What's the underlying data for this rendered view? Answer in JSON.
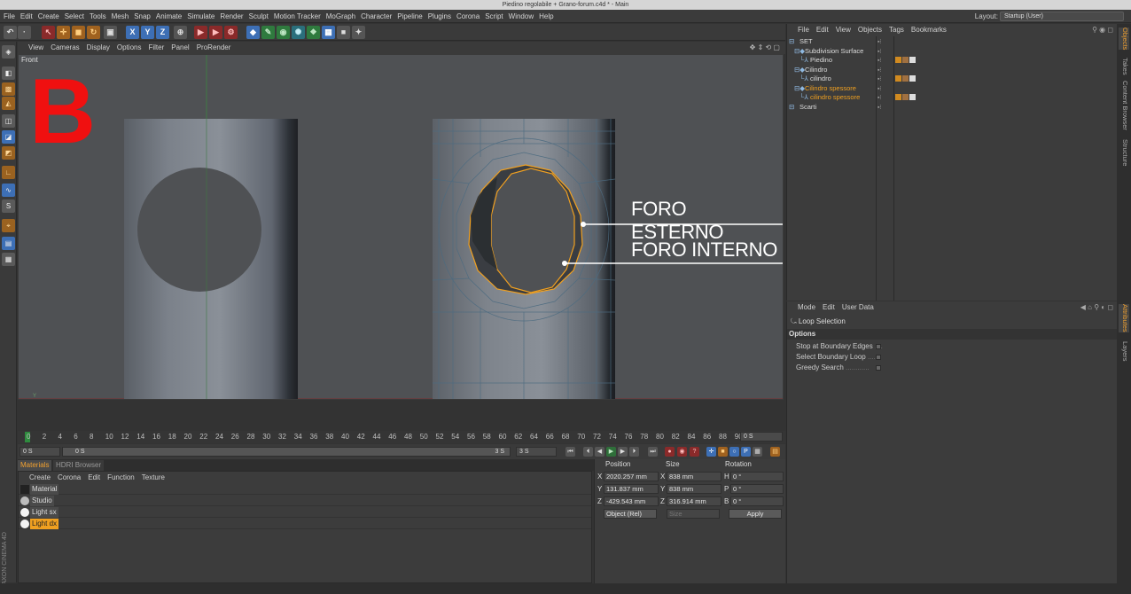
{
  "window": {
    "title": "Piedino regolabile + Grano-forum.c4d * - Main"
  },
  "menu": [
    "File",
    "Edit",
    "Create",
    "Select",
    "Tools",
    "Mesh",
    "Snap",
    "Animate",
    "Simulate",
    "Render",
    "Sculpt",
    "Motion Tracker",
    "MoGraph",
    "Character",
    "Pipeline",
    "Plugins",
    "Corona",
    "Script",
    "Window",
    "Help"
  ],
  "layout": {
    "label": "Layout:",
    "value": "Startup (User)"
  },
  "toolbar_axes": [
    "X",
    "Y",
    "Z"
  ],
  "viewport": {
    "menu": [
      "View",
      "Cameras",
      "Display",
      "Options",
      "Filter",
      "Panel",
      "ProRender"
    ],
    "label": "Front",
    "overlay_letter": "B",
    "annotations": {
      "outer": "FORO ESTERNO",
      "inner": "FORO INTERNO"
    },
    "axis": {
      "y": "Y",
      "x": "X",
      "z": "Z"
    }
  },
  "timeline": {
    "ticks": [
      "0",
      "2",
      "4",
      "6",
      "8",
      "10",
      "12",
      "14",
      "16",
      "18",
      "20",
      "22",
      "24",
      "26",
      "28",
      "30",
      "32",
      "34",
      "36",
      "38",
      "40",
      "42",
      "44",
      "46",
      "48",
      "50",
      "52",
      "54",
      "56",
      "58",
      "60",
      "62",
      "64",
      "66",
      "68",
      "70",
      "72",
      "74",
      "76",
      "78",
      "80",
      "82",
      "84",
      "86",
      "88",
      "90"
    ],
    "current": "0 S",
    "start": "0 S",
    "range_start": "0 S",
    "range_end": "3 S",
    "end": "3 S"
  },
  "materials": {
    "tabs": [
      "Materials",
      "HDRI Browser"
    ],
    "menu": [
      "Create",
      "Corona",
      "Edit",
      "Function",
      "Texture"
    ],
    "items": [
      {
        "name": "Material",
        "color": "#222222"
      },
      {
        "name": "Studio",
        "color": "#bbbbbb"
      },
      {
        "name": "Light sx",
        "color": "#f4f4f4"
      },
      {
        "name": "Light dx",
        "color": "#f4f4f4"
      }
    ]
  },
  "coords": {
    "headers": {
      "position": "Position",
      "size": "Size",
      "rotation": "Rotation"
    },
    "rows": [
      {
        "axis": "X",
        "pos": "2020.257 mm",
        "size_axis": "X",
        "size": "838 mm",
        "rot_axis": "H",
        "rot": "0 °"
      },
      {
        "axis": "Y",
        "pos": "131.837 mm",
        "size_axis": "Y",
        "size": "838 mm",
        "rot_axis": "P",
        "rot": "0 °"
      },
      {
        "axis": "Z",
        "pos": "-429.543 mm",
        "size_axis": "Z",
        "size": "316.914 mm",
        "rot_axis": "B",
        "rot": "0 °"
      }
    ],
    "mode": "Object (Rel)",
    "size_mode": "Size",
    "apply": "Apply"
  },
  "object_manager": {
    "menu": [
      "File",
      "Edit",
      "View",
      "Objects",
      "Tags",
      "Bookmarks"
    ],
    "objects": [
      {
        "name": "SET",
        "color": "#dddddd",
        "indent": 0,
        "has_tags": false
      },
      {
        "name": "Subdivision Surface",
        "color": "#dddddd",
        "indent": 1,
        "has_tags": false
      },
      {
        "name": "Piedino",
        "color": "#dddddd",
        "indent": 2,
        "has_tags": true
      },
      {
        "name": "Cilindro",
        "color": "#dddddd",
        "indent": 1,
        "has_tags": false
      },
      {
        "name": "cilindro",
        "color": "#dddddd",
        "indent": 2,
        "has_tags": true
      },
      {
        "name": "Cilindro spessore",
        "color": "#f0a020",
        "indent": 1,
        "has_tags": false
      },
      {
        "name": "cilindro spessore",
        "color": "#f0a020",
        "indent": 2,
        "has_tags": true
      },
      {
        "name": "Scarti",
        "color": "#dddddd",
        "indent": 0,
        "has_tags": false
      }
    ]
  },
  "attributes": {
    "menu": [
      "Mode",
      "Edit",
      "User Data"
    ],
    "tool": "Loop Selection",
    "section": "Options",
    "options": [
      "Stop at Boundary Edges",
      "Select Boundary Loop",
      "Greedy Search"
    ],
    "option_dots": [
      " ....",
      " ....",
      " ............"
    ]
  },
  "side_tabs": [
    "Objects",
    "Takes",
    "Content Browser",
    "Structure"
  ],
  "side_tabs2": [
    "Attributes",
    "Layers"
  ],
  "brand": "MAXON CINEMA 4D",
  "colors": {
    "accent": "#f0a020",
    "selection": "#f0a020",
    "overlay_red": "#f01010"
  }
}
